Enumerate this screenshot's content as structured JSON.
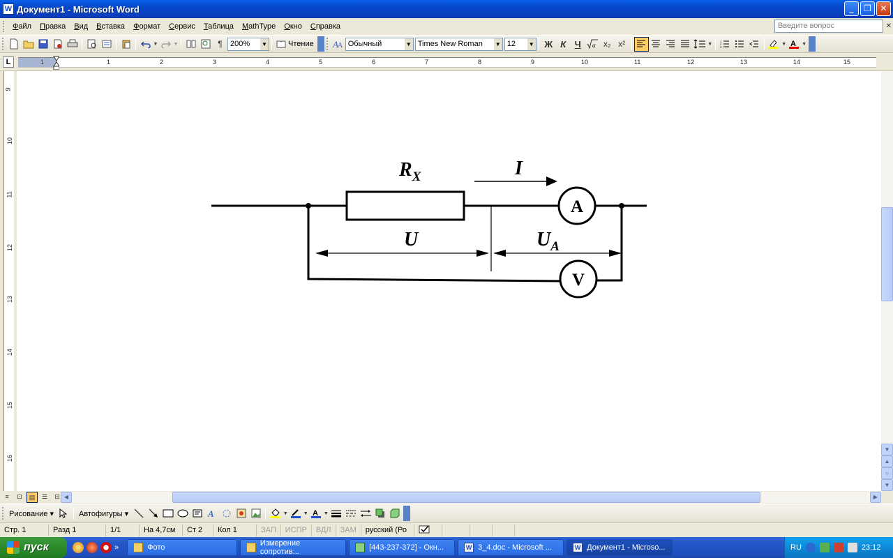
{
  "window": {
    "title": "Документ1 - Microsoft Word",
    "app_icon": "W",
    "buttons": {
      "minimize": "_",
      "maximize": "❐",
      "close": "✕"
    }
  },
  "menu": {
    "items": [
      "Файл",
      "Правка",
      "Вид",
      "Вставка",
      "Формат",
      "Сервис",
      "Таблица",
      "MathType",
      "Окно",
      "Справка"
    ],
    "help_placeholder": "Введите вопрос",
    "close_doc": "✕"
  },
  "toolbar": {
    "zoom": "200%",
    "reading_label": "Чтение",
    "style": "Обычный",
    "font": "Times New Roman",
    "font_size": "12",
    "bold": "Ж",
    "italic": "К",
    "underline": "Ч",
    "subscript": "x₂",
    "superscript": "x²",
    "pilcrow": "¶"
  },
  "ruler": {
    "corner": "L",
    "h_numbers": [
      "1",
      "2",
      "1",
      "2",
      "3",
      "4",
      "5",
      "6",
      "7",
      "8",
      "9",
      "10",
      "11",
      "12",
      "13",
      "14",
      "15"
    ],
    "v_numbers": [
      "9",
      "10",
      "11",
      "12",
      "13",
      "14",
      "15",
      "16"
    ]
  },
  "diagram": {
    "resistor_label": "R",
    "resistor_sub": "X",
    "current_label": "I",
    "ammeter": "A",
    "voltmeter": "V",
    "voltage_label": "U",
    "ammeter_voltage_label": "U",
    "ammeter_voltage_sub": "A"
  },
  "drawing_toolbar": {
    "drawing_label": "Рисование",
    "autoshapes_label": "Автофигуры"
  },
  "status": {
    "page": "Стр. 1",
    "section": "Разд 1",
    "pages": "1/1",
    "at": "На 4,7см",
    "line": "Ст 2",
    "col": "Кол 1",
    "rec": "ЗАП",
    "trk": "ИСПР",
    "ext": "ВДЛ",
    "ovr": "ЗАМ",
    "language": "русский (Ро"
  },
  "taskbar": {
    "start": "пуск",
    "tasks": [
      {
        "label": "Фото",
        "icon": "folder-icon"
      },
      {
        "label": "Измерение сопротив...",
        "icon": "folder-icon"
      },
      {
        "label": "[443-237-372] - Окн...",
        "icon": "chat-icon"
      },
      {
        "label": "3_4.doc - Microsoft ...",
        "icon": "word-icon"
      },
      {
        "label": "Документ1 - Microso...",
        "icon": "word-icon"
      }
    ],
    "lang": "RU",
    "clock": "23:12"
  },
  "colors": {
    "titlebar": "#0447c8",
    "taskbar": "#2456c7",
    "start": "#2b8a2b",
    "tray": "#0e8ad8"
  }
}
